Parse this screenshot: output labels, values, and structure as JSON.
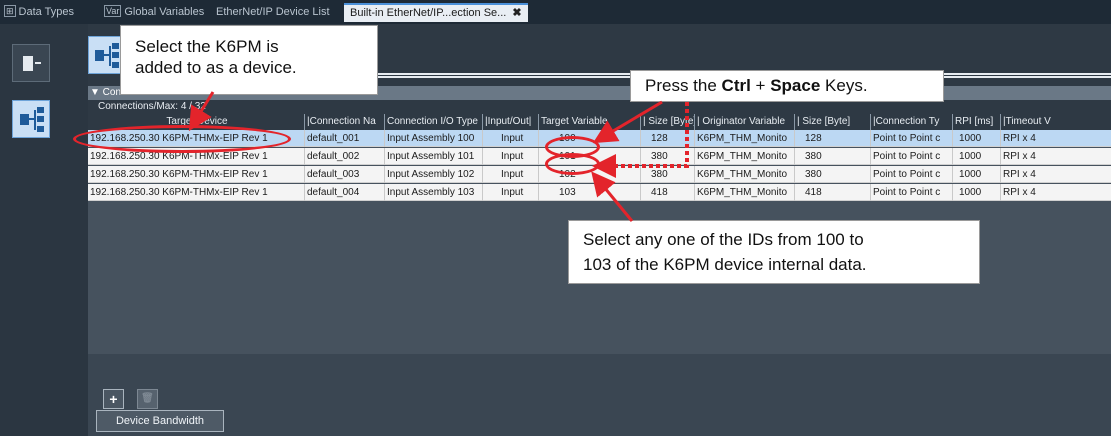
{
  "tabs": [
    {
      "icon": "⊞",
      "label": "Data Types"
    },
    {
      "icon": "Var",
      "label": "Global Variables"
    },
    {
      "label": "EtherNet/IP Device List"
    },
    {
      "label": "Built-in EtherNet/IP...ection Se...",
      "close": "✖"
    }
  ],
  "section": {
    "title": "▼ Connection",
    "connections_max": "Connections/Max: 4 / 32"
  },
  "table": {
    "headers": [
      "Target Device",
      "|Connection Na",
      "Connection I/O Type",
      "|Input/Out|",
      "Target Variable",
      "| Size [Byte]",
      "| Originator Variable",
      "| Size [Byte]",
      "|Connection Ty",
      "RPI [ms]",
      "|Timeout V"
    ],
    "rows": [
      [
        "192.168.250.30 K6PM-THMx-EIP Rev 1",
        "default_001",
        "Input Assembly 100",
        "Input",
        "100",
        "128",
        "K6PM_THM_Monito",
        "128",
        "Point to Point c",
        "1000",
        "RPI x 4"
      ],
      [
        "192.168.250.30 K6PM-THMx-EIP Rev 1",
        "default_002",
        "Input Assembly 101",
        "Input",
        "101",
        "380",
        "K6PM_THM_Monito",
        "380",
        "Point to Point c",
        "1000",
        "RPI x 4"
      ],
      [
        "192.168.250.30 K6PM-THMx-EIP Rev 1",
        "default_003",
        "Input Assembly 102",
        "Input",
        "102",
        "380",
        "K6PM_THM_Monito",
        "380",
        "Point to Point c",
        "1000",
        "RPI x 4"
      ],
      [
        "192.168.250.30 K6PM-THMx-EIP Rev 1",
        "default_004",
        "Input Assembly 103",
        "Input",
        "103",
        "418",
        "K6PM_THM_Monito",
        "418",
        "Point to Point c",
        "1000",
        "RPI x 4"
      ]
    ]
  },
  "buttons": {
    "add": "+",
    "delete": "🗑",
    "device_bandwidth": "Device Bandwidth"
  },
  "callouts": {
    "select_k6pm_line1": "Select the K6PM is",
    "select_k6pm_line2": "added to as a device.",
    "press_pre": "Press the ",
    "press_ctrl": "Ctrl",
    "press_plus": " + ",
    "press_space": "Space",
    "press_post": " Keys.",
    "select_ids_line1": "Select any one of the IDs from 100 to",
    "select_ids_line2": "103 of the K6PM device internal data."
  },
  "colors": {
    "annotation": "#e3242b",
    "selected_row": "#bcd8f3"
  }
}
